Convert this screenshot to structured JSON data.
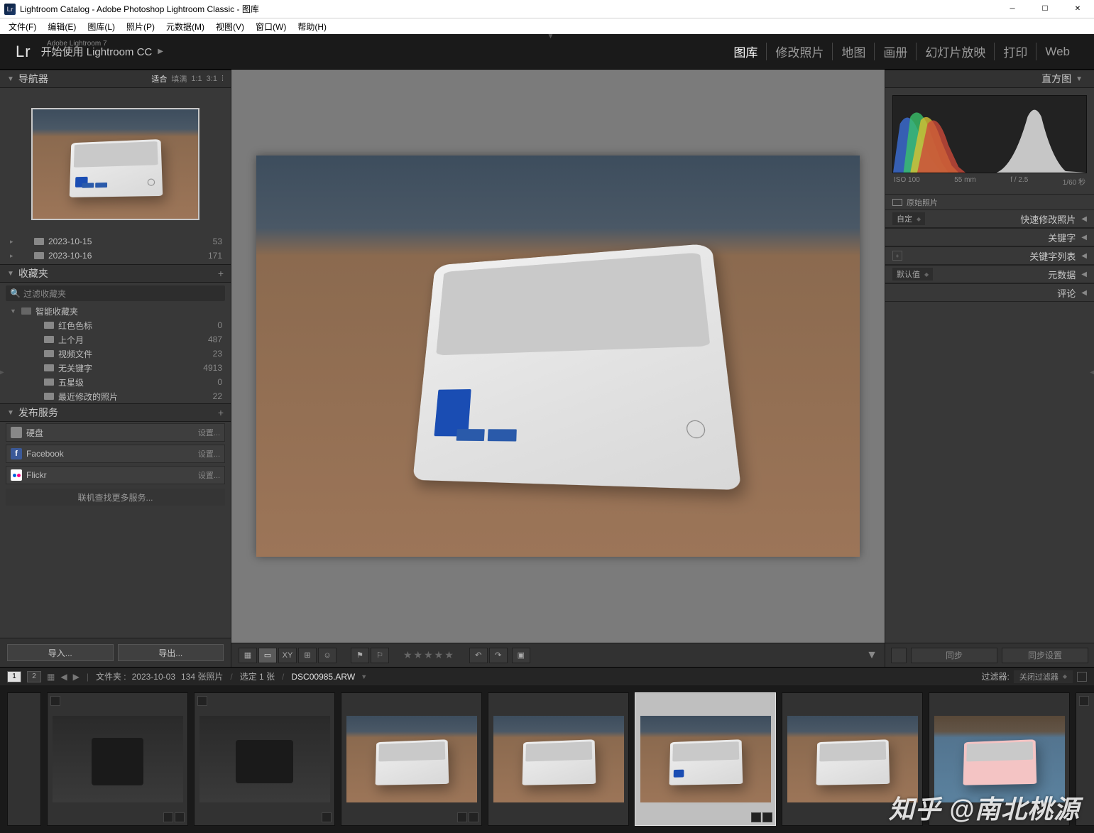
{
  "window": {
    "title": "Lightroom Catalog - Adobe Photoshop Lightroom Classic - 图库",
    "logo_text": "Lr"
  },
  "menubar": [
    "文件(F)",
    "编辑(E)",
    "图库(L)",
    "照片(P)",
    "元数据(M)",
    "视图(V)",
    "窗口(W)",
    "帮助(H)"
  ],
  "header": {
    "logo": "Lr",
    "sub": "Adobe Lightroom 7",
    "start": "开始使用 Lightroom CC"
  },
  "modules": [
    {
      "label": "图库",
      "active": true
    },
    {
      "label": "修改照片",
      "active": false
    },
    {
      "label": "地图",
      "active": false
    },
    {
      "label": "画册",
      "active": false
    },
    {
      "label": "幻灯片放映",
      "active": false
    },
    {
      "label": "打印",
      "active": false
    },
    {
      "label": "Web",
      "active": false
    }
  ],
  "left": {
    "navigator": {
      "title": "导航器",
      "modes": [
        "适合",
        "填满",
        "1:1",
        "3:1"
      ],
      "active": "适合"
    },
    "folders": [
      {
        "label": "2023-10-15",
        "count": "53"
      },
      {
        "label": "2023-10-16",
        "count": "171"
      }
    ],
    "collections": {
      "title": "收藏夹",
      "filter": "过滤收藏夹",
      "smart_label": "智能收藏夹",
      "items": [
        {
          "label": "红色色标",
          "count": "0"
        },
        {
          "label": "上个月",
          "count": "487"
        },
        {
          "label": "视频文件",
          "count": "23"
        },
        {
          "label": "无关键字",
          "count": "4913"
        },
        {
          "label": "五星级",
          "count": "0"
        },
        {
          "label": "最近修改的照片",
          "count": "22"
        }
      ]
    },
    "publish": {
      "title": "发布服务",
      "services": [
        {
          "label": "硬盘",
          "set": "设置...",
          "color": "#666"
        },
        {
          "label": "Facebook",
          "set": "设置...",
          "color": "#3b5998"
        },
        {
          "label": "Flickr",
          "set": "设置...",
          "color": "#ff0084"
        }
      ],
      "more": "联机查找更多服务..."
    },
    "import_btn": "导入...",
    "export_btn": "导出..."
  },
  "right": {
    "histogram": {
      "title": "直方图",
      "iso": "ISO 100",
      "focal": "55 mm",
      "aperture": "f / 2.5",
      "shutter": "1/60 秒",
      "raw": "原始照片"
    },
    "panels": [
      {
        "pre": "自定",
        "label": "快速修改照片"
      },
      {
        "label": "关键字"
      },
      {
        "plus": true,
        "label": "关键字列表"
      },
      {
        "pre": "默认值",
        "label": "元数据"
      },
      {
        "label": "评论"
      }
    ],
    "sync": "同步",
    "sync_settings": "同步设置"
  },
  "status": {
    "pages": [
      "1",
      "2"
    ],
    "path_prefix": "文件夹 :",
    "path": "2023-10-03",
    "count": "134 张照片",
    "selected": "选定 1 张",
    "filename": "DSC00985.ARW",
    "filter_label": "过滤器:",
    "filter_value": "关闭过滤器"
  },
  "watermark": "知乎 @南北桃源"
}
